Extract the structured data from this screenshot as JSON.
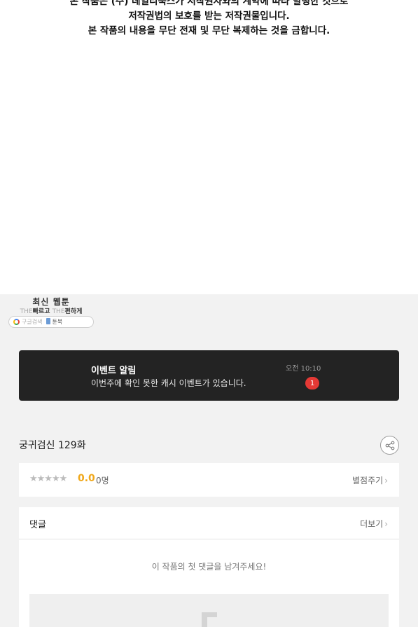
{
  "copyright": {
    "lines": [
      "본 작품은 (주) 데일리북스가 저작권자와의 계약에 따라 발행한 것으로",
      "저작권법의 보호를 받는 저작권물입니다.",
      "본 작품의 내용을 무단 전재 및 무단 복제하는 것을 금합니다."
    ]
  },
  "logo": {
    "title": "최신 웹툰",
    "tagline_the1": "THE",
    "tagline_fast": "빠르고",
    "tagline_the2": "THE",
    "tagline_easy": "편하게",
    "search_label": "구글검색",
    "brand": "툰북"
  },
  "notice": {
    "title": "이벤트 알림",
    "message": "이번주에 확인 못한 캐시 이벤트가 있습니다.",
    "time": "오전 10:10",
    "badge": "1"
  },
  "episode": {
    "title": "궁귀검신 129화",
    "share_icon": "share-icon"
  },
  "rating": {
    "stars": "★★★★★",
    "score": "0.0",
    "count": "0명",
    "rate_label": "별점주기",
    "star_color": "#bcbcbc",
    "score_color": "#f0a81b"
  },
  "comments": {
    "label": "댓글",
    "more_label": "더보기",
    "empty_message": "이 작품의 첫 댓글을 남겨주세요!"
  },
  "colors": {
    "notice_bg": "#232323",
    "badge": "#e53935",
    "band_bg": "#f2f2f2"
  }
}
